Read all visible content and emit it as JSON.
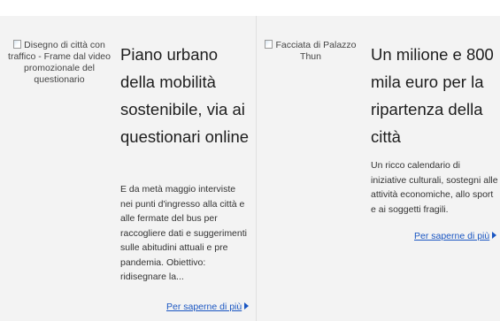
{
  "articles": [
    {
      "image_alt": "Disegno di città con traffico - Frame dal video promozionale del questionario",
      "title": "Piano urbano della mobilità sostenibile, via ai questionari online",
      "summary": "E da metà maggio interviste nei punti d'ingresso alla città e alle fermate del bus per raccogliere dati e suggerimenti sulle abitudini attuali e pre pandemia. Obiettivo: ridisegnare la...",
      "more_label": "Per saperne di più"
    },
    {
      "image_alt": "Facciata di Palazzo Thun",
      "title": "Un milione e 800 mila euro per la ripartenza della città",
      "summary": "Un ricco calendario di iniziative culturali, sostegni alle attività economiche, allo sport e ai soggetti fragili.",
      "more_label": "Per saperne di più"
    }
  ],
  "icons": {
    "broken_image": "broken-image-icon",
    "arrow": "triangle-right-icon"
  },
  "colors": {
    "link": "#1a56c2",
    "background": "#f3f3f3"
  }
}
